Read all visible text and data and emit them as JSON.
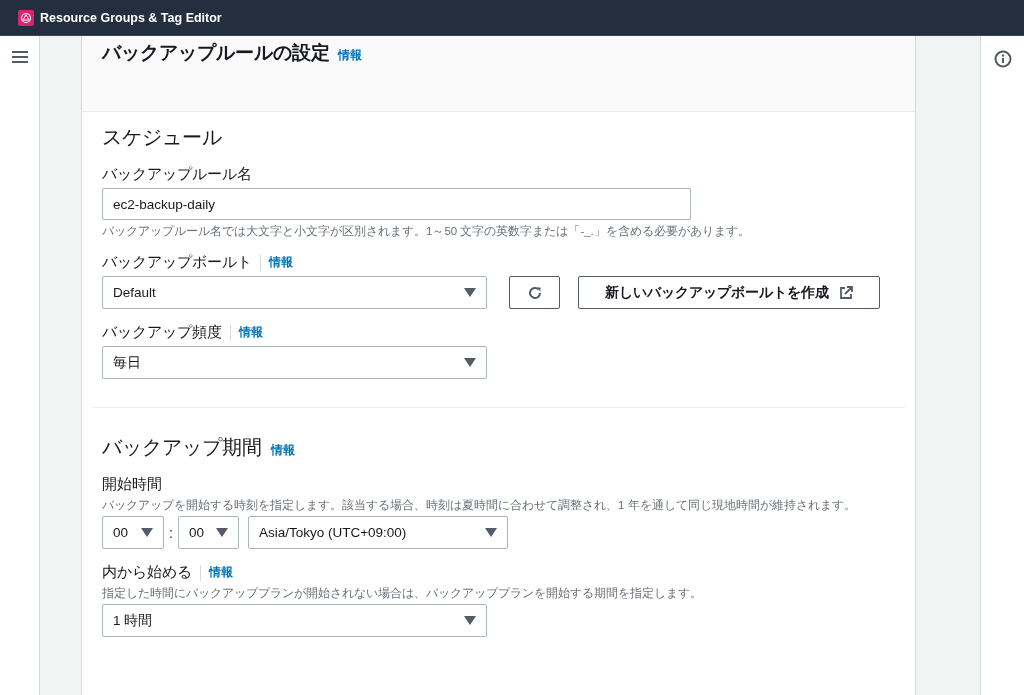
{
  "app": {
    "title": "Resource Groups & Tag Editor"
  },
  "panel": {
    "title": "バックアップルールの設定",
    "info": "情報"
  },
  "sections": [
    {
      "title": "スケジュール",
      "fields": [
        {
          "kind": "text",
          "label": "バックアップルール名",
          "value": "ec2-backup-daily",
          "hint": "バックアップルール名では大文字と小文字が区別されます。1～50 文字の英数字または「-_.」を含める必要があります。"
        },
        {
          "kind": "select-actions",
          "label": "バックアップボールト",
          "info": "情報",
          "value": "Default",
          "action": "新しいバックアップボールトを作成"
        },
        {
          "kind": "select",
          "label": "バックアップ頻度",
          "info": "情報",
          "value": "毎日"
        }
      ]
    },
    {
      "title": "バックアップ期間",
      "info": "情報",
      "fields": [
        {
          "kind": "time",
          "label": "開始時間",
          "hint": "バックアップを開始する時刻を指定します。該当する場合、時刻は夏時間に合わせて調整され、1 年を通して同じ現地時間が維持されます。",
          "hour": "00",
          "separator": ":",
          "minute": "00",
          "timezone": "Asia/Tokyo (UTC+09:00)"
        },
        {
          "kind": "select",
          "label": "内から始める",
          "info": "情報",
          "hint": "指定した時間にバックアッププランが開始されない場合は、バックアッププランを開始する期間を指定します。",
          "value": "1 時間"
        }
      ]
    }
  ]
}
